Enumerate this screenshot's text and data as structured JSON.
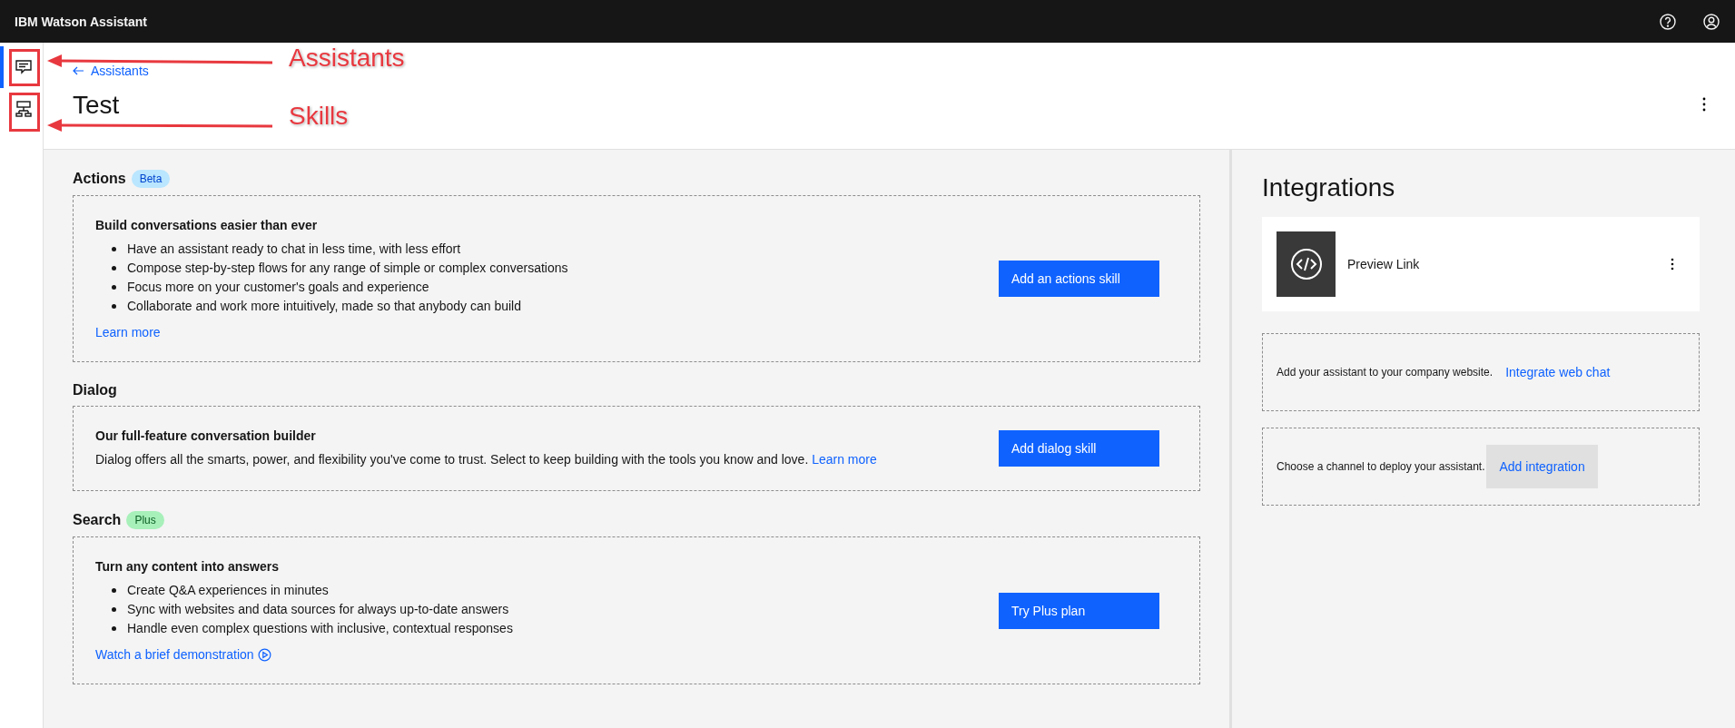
{
  "header": {
    "title": "IBM Watson Assistant"
  },
  "sidebar": {
    "items": [
      {
        "kind": "chat",
        "selected": true
      },
      {
        "kind": "flow",
        "selected": false
      }
    ]
  },
  "breadcrumb": "Assistants",
  "page_title": "Test",
  "sections": [
    {
      "kind": "bullets",
      "heading": "Actions",
      "badge": {
        "label": "Beta",
        "color": "#bae6ff"
      },
      "title": "Build conversations easier than ever",
      "bullets": [
        "Have an assistant ready to chat in less time, with less effort",
        "Compose step-by-step flows for any range of simple or complex conversations",
        "Focus more on your customer's goals and experience",
        "Collaborate and work more intuitively, made so that anybody can build"
      ],
      "link": {
        "label": "Learn more",
        "kind": "plain"
      },
      "button": "Add an actions skill"
    },
    {
      "kind": "paragraph",
      "heading": "Dialog",
      "title": "Our full-feature conversation builder",
      "text": "Dialog offers all the smarts, power, and flexibility you've come to trust. Select to keep building with the tools you know and love.",
      "link": {
        "label": "Learn more",
        "kind": "plain"
      },
      "button": "Add dialog skill"
    },
    {
      "kind": "bullets",
      "heading": "Search",
      "badge": {
        "label": "Plus",
        "color": "#a7f0ba"
      },
      "title": "Turn any content into answers",
      "bullets": [
        "Create Q&A experiences in minutes",
        "Sync with websites and data sources for always up-to-date answers",
        "Handle even complex questions with inclusive, contextual responses"
      ],
      "link": {
        "label": "Watch a brief demonstration",
        "kind": "video"
      },
      "button": "Try Plus plan"
    }
  ],
  "integrations": {
    "title": "Integrations",
    "card": {
      "label": "Preview Link"
    },
    "prompts": [
      {
        "text": "Add your assistant to your company website.",
        "action": {
          "label": "Integrate web chat",
          "kind": "link"
        }
      },
      {
        "text": "Choose a channel to deploy your assistant.",
        "action": {
          "label": "Add integration",
          "kind": "button"
        }
      }
    ]
  },
  "annotations": [
    {
      "label": "Assistants"
    },
    {
      "label": "Skills"
    }
  ]
}
